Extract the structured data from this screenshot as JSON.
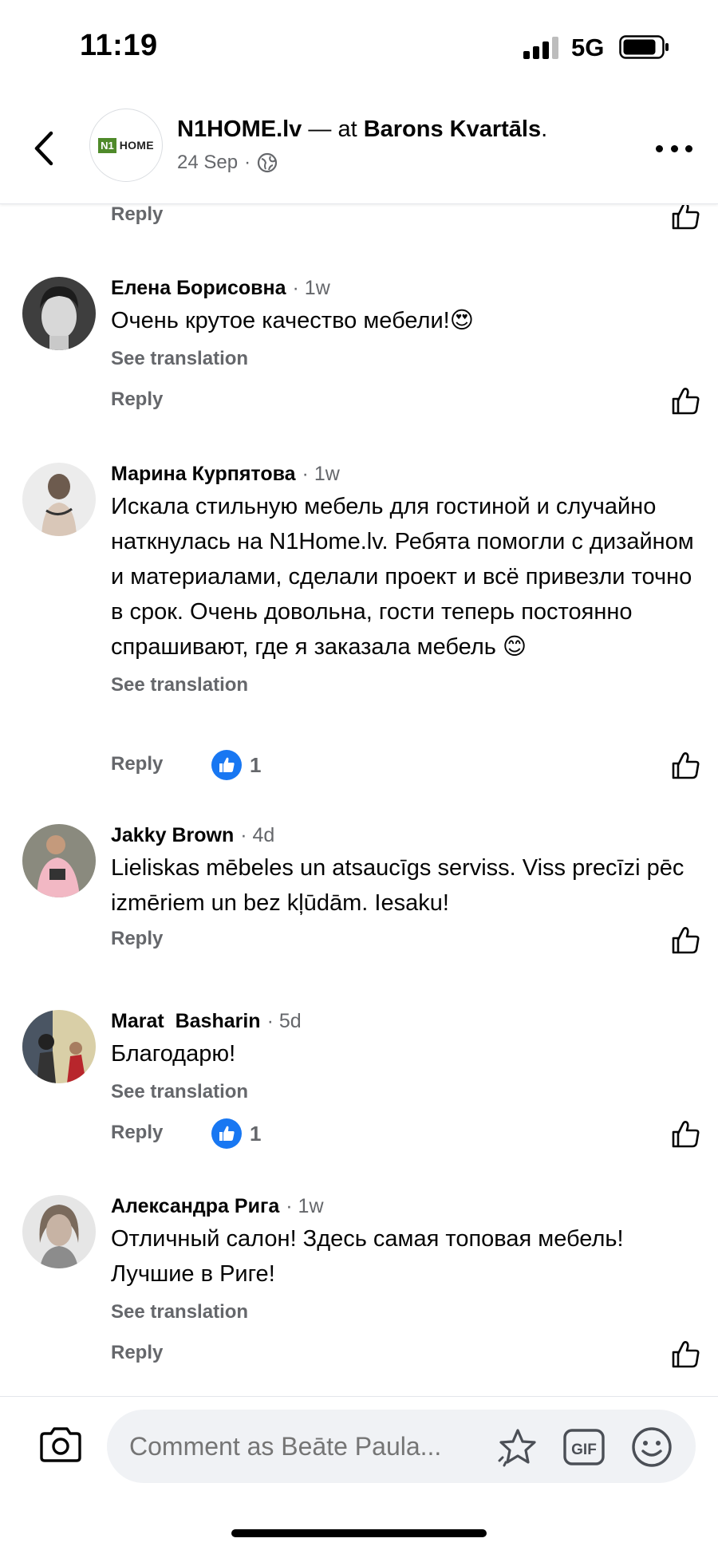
{
  "status_bar": {
    "time": "11:19",
    "network": "5G"
  },
  "header": {
    "page_name": "N1HOME.lv",
    "connector": " — at ",
    "location": "Barons Kvartāls",
    "suffix": ".",
    "date": "24 Sep",
    "separator": "·",
    "privacy_icon": "globe-icon",
    "logo_badge": "N1",
    "logo_text": "HOME"
  },
  "labels": {
    "reply": "Reply",
    "see_translation": "See translation"
  },
  "comments": [
    {
      "name": "Елена Борисовна",
      "time": "1w",
      "text": "Очень крутое качество мебели!😍",
      "see_translation": "See translation",
      "reply": "Reply",
      "reactions": null
    },
    {
      "name": "Марина Курпятова",
      "time": "1w",
      "text": "Искала стильную мебель для гостиной и случайно наткнулась на N1Home.lv. Ребята помогли с дизайном и материалами, сделали проект и всё привезли точно в срок. Очень довольна, гости теперь постоянно спрашивают, где я заказала мебель 😊",
      "see_translation": "See translation",
      "reply": "Reply",
      "reactions": "1"
    },
    {
      "name": "Jakky Brown",
      "time": "4d",
      "text": "Lieliskas mēbeles un atsaucīgs serviss. Viss precīzi pēc izmēriem un bez kļūdām. Iesaku!",
      "see_translation": "",
      "reply": "Reply",
      "reactions": null
    },
    {
      "name": "Marat  Basharin",
      "time": "5d",
      "text": "Благодарю!",
      "see_translation": "See translation",
      "reply": "Reply",
      "reactions": "1"
    },
    {
      "name": "Александра Рига",
      "time": "1w",
      "text": "Отличный салон! Здесь самая топовая мебель! Лучшие в Риге!",
      "see_translation": "See translation",
      "reply": "Reply",
      "reactions": null
    }
  ],
  "composer": {
    "placeholder": "Comment as Beāte Paula...",
    "gif_label": "GIF"
  },
  "colors": {
    "accent": "#1877f2",
    "muted": "#65676b",
    "logo_green": "#4f8a2a"
  }
}
